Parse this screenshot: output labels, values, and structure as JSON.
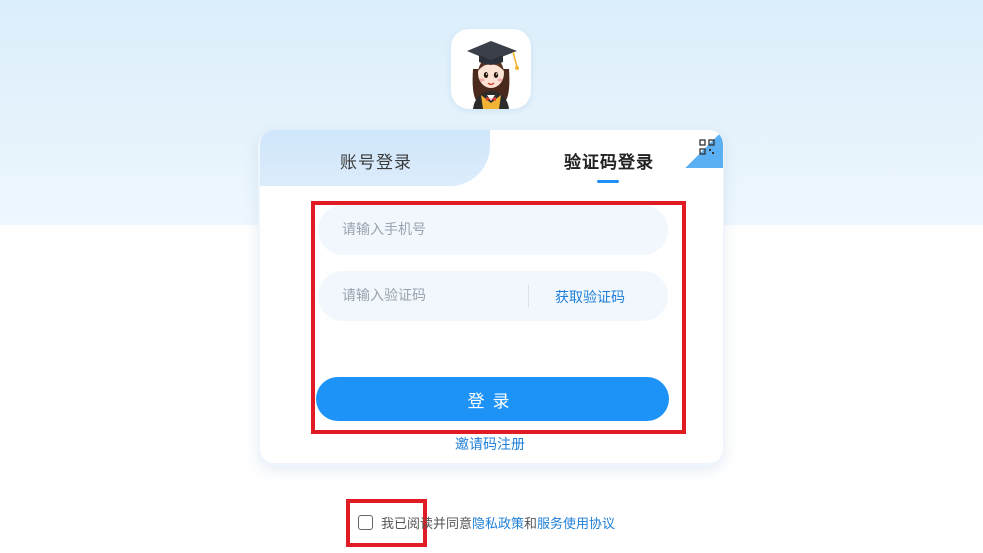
{
  "tabs": {
    "account_label": "账号登录",
    "sms_label": "验证码登录",
    "active": "sms"
  },
  "form": {
    "phone_placeholder": "请输入手机号",
    "code_placeholder": "请输入验证码",
    "get_code_label": "获取验证码",
    "login_label": "登录",
    "invite_label": "邀请码注册"
  },
  "agreement": {
    "prefix": "我已阅读并同意",
    "privacy_label": "隐私政策",
    "conjunction": "和",
    "terms_label": "服务使用协议",
    "checked": false
  },
  "icons": {
    "logo": "graduate-avatar-icon",
    "qr": "qr-code-icon"
  },
  "colors": {
    "accent": "#1e93f7",
    "link": "#1e7fd8",
    "highlight": "#e01b24"
  }
}
